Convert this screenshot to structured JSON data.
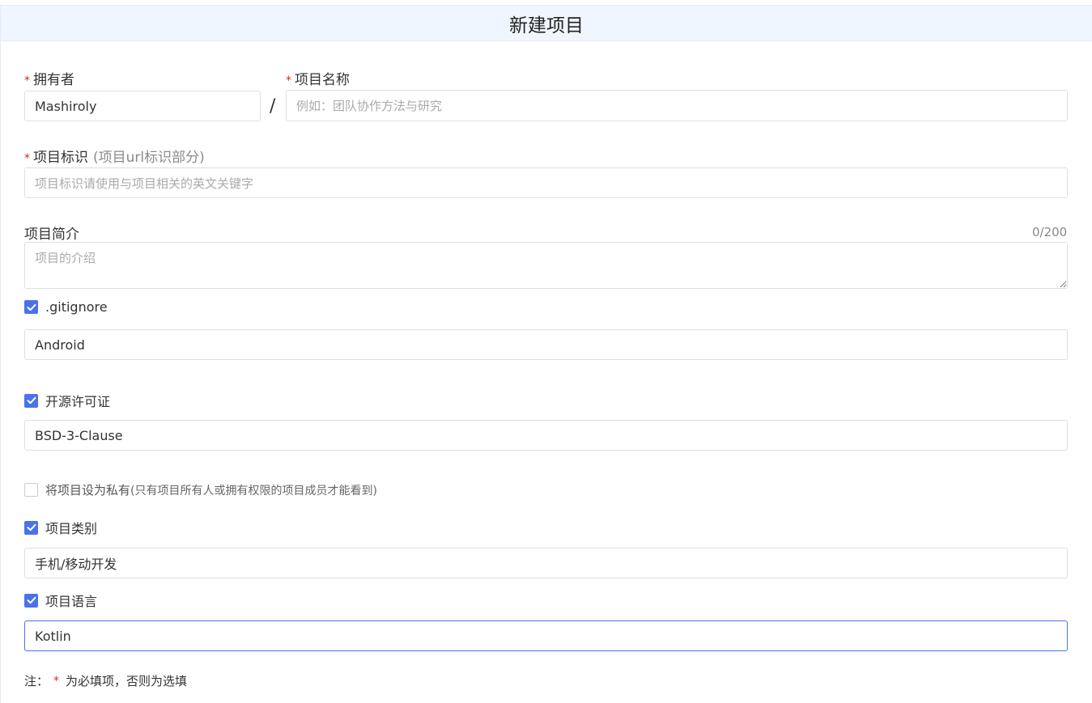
{
  "header": {
    "title": "新建项目"
  },
  "owner": {
    "label": "拥有者",
    "value": "Mashiroly"
  },
  "separator": "/",
  "project_name": {
    "label": "项目名称",
    "placeholder": "例如：团队协作方法与研究",
    "value": ""
  },
  "project_id": {
    "label": "项目标识",
    "hint": "(项目url标识部分)",
    "placeholder": "项目标识请使用与项目相关的英文关键字",
    "value": ""
  },
  "description": {
    "label": "项目简介",
    "placeholder": "项目的介绍",
    "counter": "0/200",
    "value": ""
  },
  "gitignore": {
    "label": ".gitignore",
    "checked": true,
    "value": "Android"
  },
  "license": {
    "label": "开源许可证",
    "checked": true,
    "value": "BSD-3-Clause"
  },
  "private": {
    "label": "将项目设为私有",
    "sub": "(只有项目所有人或拥有权限的项目成员才能看到)",
    "checked": false
  },
  "category": {
    "label": "项目类别",
    "checked": true,
    "value": "手机/移动开发"
  },
  "language": {
    "label": "项目语言",
    "checked": true,
    "value": "Kotlin"
  },
  "note": {
    "prefix": "注：",
    "star": "*",
    "text": "为必填项，否则为选填"
  },
  "colors": {
    "accent": "#4a73e8",
    "required": "#e0241b",
    "header_bg": "#f0f6ff"
  }
}
